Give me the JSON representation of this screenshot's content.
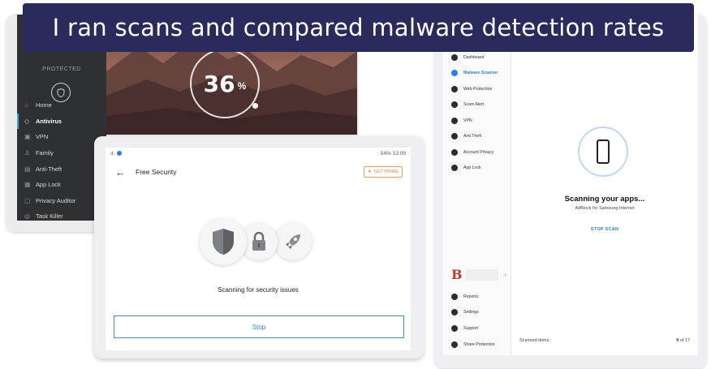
{
  "banner": {
    "title": "I ran scans and compared malware detection rates"
  },
  "antivirus_app": {
    "status_label": "PROTECTED",
    "scan_percent": "36",
    "percent_sign": "%",
    "menu": [
      {
        "label": "Home",
        "icon": "home-icon",
        "active": false
      },
      {
        "label": "Antivirus",
        "icon": "shield-icon",
        "active": true
      },
      {
        "label": "VPN",
        "icon": "vpn-icon",
        "active": false
      },
      {
        "label": "Family",
        "icon": "family-icon",
        "active": false
      },
      {
        "label": "Anti-Theft",
        "icon": "anti-theft-icon",
        "active": false
      },
      {
        "label": "App Lock",
        "icon": "lock-icon",
        "active": false
      },
      {
        "label": "Privacy Auditor",
        "icon": "privacy-icon",
        "active": false
      },
      {
        "label": "Task Killer",
        "icon": "task-killer-icon",
        "active": false
      }
    ]
  },
  "free_security": {
    "status_left": "ıt.",
    "status_right": "54% 13:09",
    "title": "Free Security",
    "premium_label": "GET PRIME",
    "scan_status": "Scanning for security issues",
    "stop_label": "Stop"
  },
  "adblock_scanner": {
    "menu": [
      {
        "label": "Dashboard",
        "active": false
      },
      {
        "label": "Malware Scanner",
        "active": true
      },
      {
        "label": "Web Protection",
        "active": false
      },
      {
        "label": "Scam Alert",
        "active": false
      },
      {
        "label": "VPN",
        "active": false
      },
      {
        "label": "Anti Theft",
        "active": false
      },
      {
        "label": "Account Privacy",
        "active": false
      },
      {
        "label": "App Lock",
        "active": false
      }
    ],
    "bottom_menu": [
      {
        "label": "Reports"
      },
      {
        "label": "Settings"
      },
      {
        "label": "Support"
      },
      {
        "label": "Share Protection"
      }
    ],
    "brand_letter": "B",
    "scan_title": "Scanning your apps...",
    "scan_subtitle": "AdBlock for Samsung Internet",
    "stop_label": "STOP SCAN",
    "scanned_label": "Scanned items:",
    "scanned_count": "9",
    "scanned_total": "of 17"
  }
}
